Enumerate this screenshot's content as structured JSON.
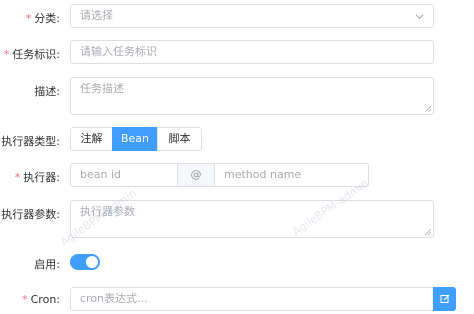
{
  "form": {
    "category": {
      "label": "分类:",
      "placeholder": "请选择"
    },
    "task_id": {
      "label": "任务标识:",
      "placeholder": "请输入任务标识"
    },
    "description": {
      "label": "描述:",
      "placeholder": "任务描述"
    },
    "executor_type": {
      "label": "执行器类型:",
      "options": [
        "注解",
        "Bean",
        "脚本"
      ],
      "selected": "Bean"
    },
    "executor": {
      "label": "执行器:",
      "bean_placeholder": "bean id",
      "separator": "@",
      "method_placeholder": "method name"
    },
    "executor_params": {
      "label": "执行器参数:",
      "placeholder": "执行器参数"
    },
    "enabled": {
      "label": "启用:",
      "value": true
    },
    "cron": {
      "label": "Cron:",
      "placeholder": "cron表达式...",
      "button_icon": "edit-icon"
    }
  },
  "watermark": {
    "text": "AgileBPM-admin"
  },
  "colors": {
    "primary": "#409eff",
    "required": "#f56c6c",
    "border": "#dcdfe6",
    "placeholder": "#a8abb2"
  }
}
